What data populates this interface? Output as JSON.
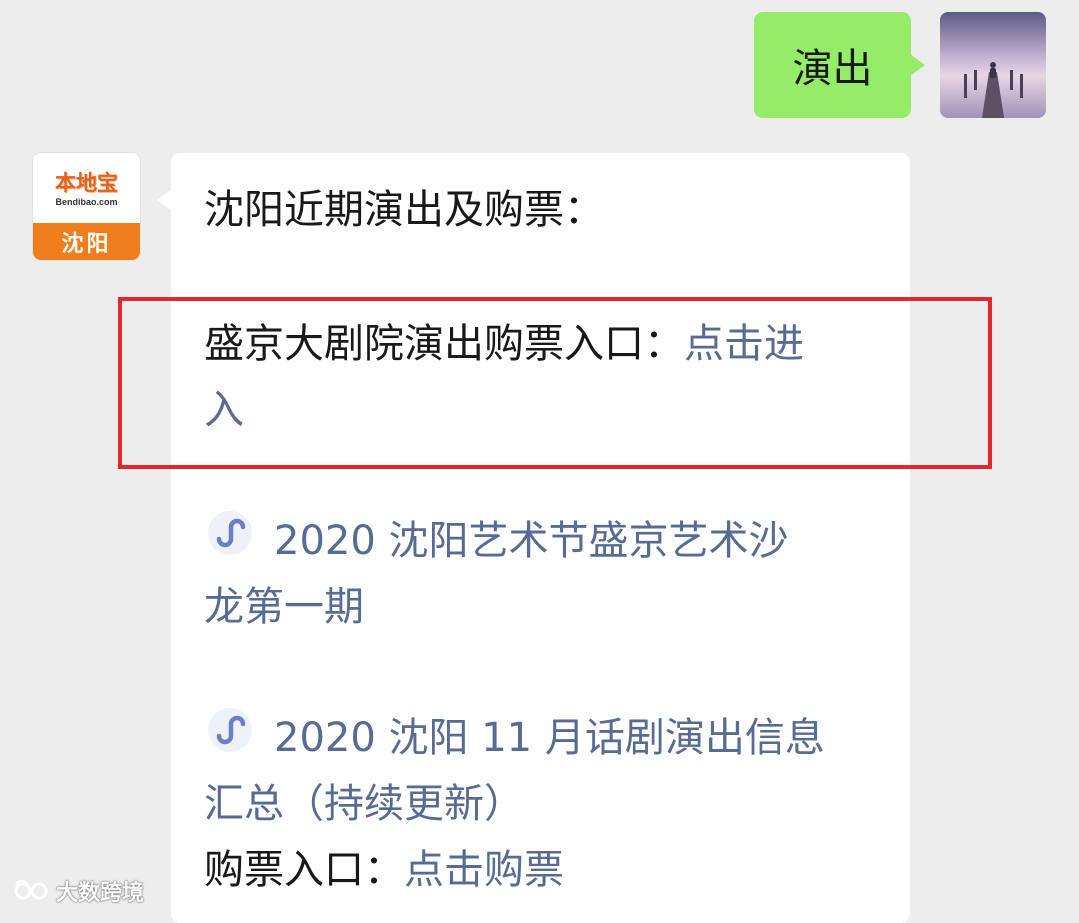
{
  "outgoing": {
    "text": "演出"
  },
  "incoming": {
    "sender_logo": {
      "brand_text": "本地宝",
      "site_text": "Bendibao.com",
      "city_text": "沈阳"
    },
    "heading": "沈阳近期演出及购票：",
    "highlighted_entry": {
      "label": "盛京大剧院演出购票入口：",
      "link_line1": "点击进",
      "link_line2": "入"
    },
    "mini_program_links": [
      {
        "icon": "mini-program-icon",
        "line1": "2020 沈阳艺术节盛京艺术沙",
        "line2": "龙第一期"
      },
      {
        "icon": "mini-program-icon",
        "line1": "2020 沈阳 11 月话剧演出信息",
        "line2": "汇总（持续更新）"
      }
    ],
    "ticket_entry": {
      "label": "购票入口：",
      "link": "点击购票"
    }
  },
  "watermark": {
    "text": "大数跨境"
  },
  "colors": {
    "background": "#ededed",
    "outgoing_bubble": "#95ec69",
    "incoming_bubble": "#ffffff",
    "link": "#576b95",
    "highlight_border": "#e0282e",
    "logo_orange": "#f07e1e"
  }
}
